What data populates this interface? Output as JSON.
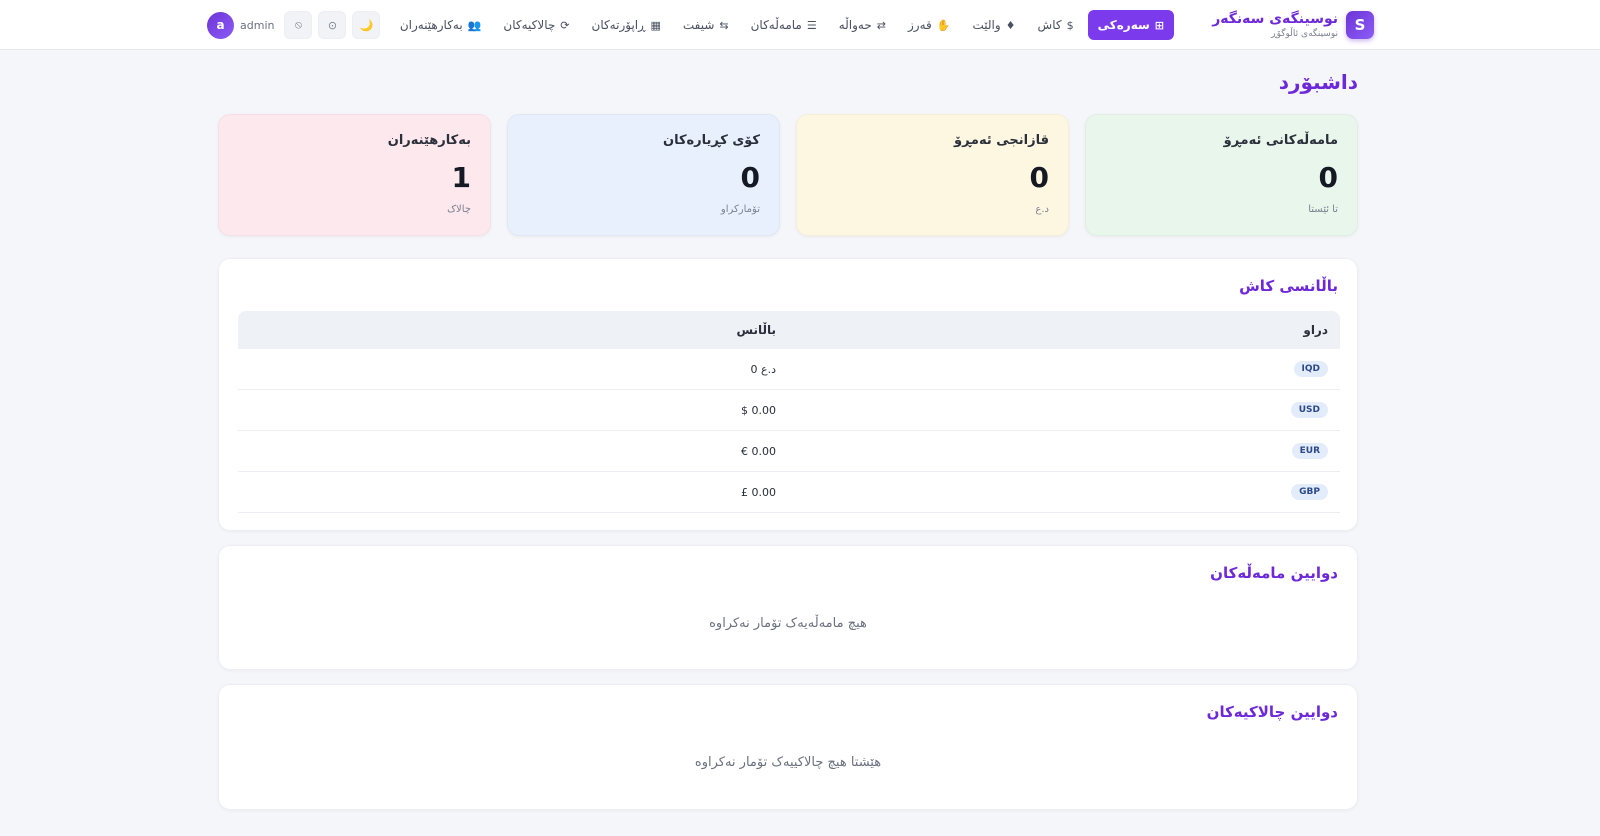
{
  "brand": {
    "logo_letter": "S",
    "name": "نوسینگەی سەنگەر",
    "subtitle": "نوسینگەی ئاڵوگۆڕ"
  },
  "nav": {
    "items": [
      {
        "label": "سەرەکی",
        "icon": "grid-icon",
        "glyph": "⊞",
        "active": true
      },
      {
        "label": "کاش",
        "icon": "dollar-icon",
        "glyph": "$"
      },
      {
        "label": "والێت",
        "icon": "diamond-icon",
        "glyph": "♦"
      },
      {
        "label": "قەرز",
        "icon": "handshake-icon",
        "glyph": "✋"
      },
      {
        "label": "حەواڵە",
        "icon": "transfer-icon",
        "glyph": "⇄"
      },
      {
        "label": "مامەڵەکان",
        "icon": "list-icon",
        "glyph": "☰"
      },
      {
        "label": "شیفت",
        "icon": "swap-icon",
        "glyph": "⇆"
      },
      {
        "label": "ڕاپۆرتەکان",
        "icon": "table-icon",
        "glyph": "▦"
      },
      {
        "label": "چالاکیەکان",
        "icon": "refresh-icon",
        "glyph": "⟳"
      },
      {
        "label": "بەکارهێنەران",
        "icon": "users-icon",
        "glyph": "👥"
      }
    ]
  },
  "user": {
    "avatar_letter": "a",
    "username": "admin",
    "logout_glyph": "⦸",
    "settings_glyph": "⊙",
    "theme_glyph": "🌙"
  },
  "page": {
    "title": "داشبۆرد"
  },
  "stats": [
    {
      "label": "مامەڵەکانی ئەمڕۆ",
      "value": "0",
      "sub": "تا ئێستا",
      "color": "#e9f6ec"
    },
    {
      "label": "قازانجی ئەمڕۆ",
      "value": "0",
      "sub": "د.ع",
      "color": "#fdf7e2"
    },
    {
      "label": "کۆی کڕیارەکان",
      "value": "0",
      "sub": "تۆمارکراو",
      "color": "#e7f0fc"
    },
    {
      "label": "بەکارهێنەران",
      "value": "1",
      "sub": "چالاک",
      "color": "#fde8ee"
    }
  ],
  "cash_balance": {
    "title": "باڵانسی کاش",
    "columns": [
      "دراو",
      "باڵانس"
    ],
    "rows": [
      {
        "currency": "IQD",
        "balance": "0 د.ع"
      },
      {
        "currency": "USD",
        "balance": "$ 0.00"
      },
      {
        "currency": "EUR",
        "balance": "€ 0.00"
      },
      {
        "currency": "GBP",
        "balance": "£ 0.00"
      }
    ]
  },
  "recent_transactions": {
    "title": "دوایین مامەڵەکان",
    "empty_text": "هیچ مامەڵەیەک تۆمار نەکراوە"
  },
  "recent_activities": {
    "title": "دوایین چالاکیەکان",
    "empty_text": "هێشتا هیچ چالاکییەک تۆمار نەکراوە"
  },
  "colors": {
    "accent": "#7c3aed",
    "accent_text": "#6d28d9",
    "background": "#f5f6fa"
  }
}
